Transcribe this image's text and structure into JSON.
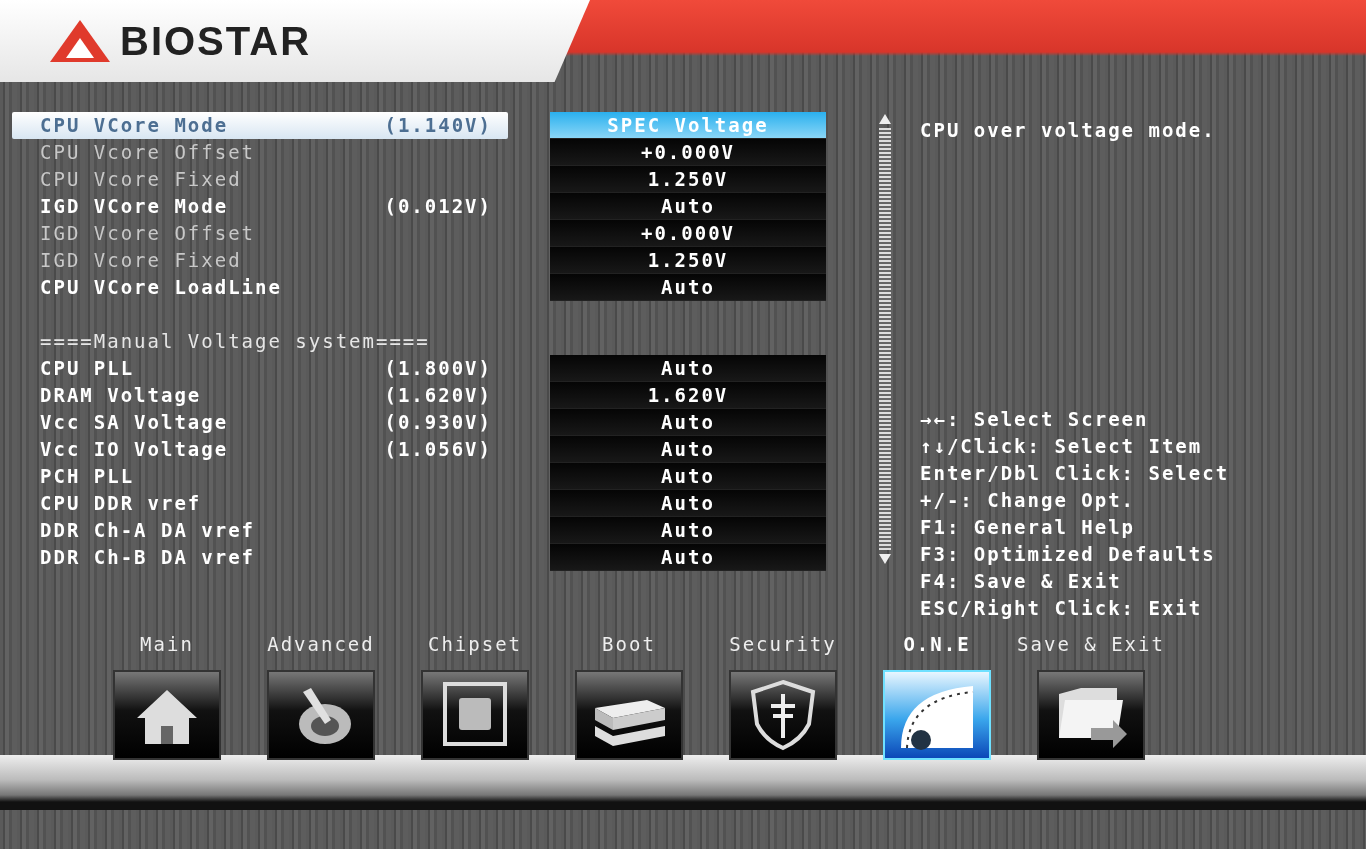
{
  "brand": {
    "name": "BIOSTAR"
  },
  "settings": [
    {
      "kind": "setting",
      "label": "CPU VCore Mode",
      "reading": "(1.140V)",
      "value": "SPEC Voltage",
      "disabled": false,
      "selected": true
    },
    {
      "kind": "setting",
      "label": "CPU Vcore Offset",
      "value": "+0.000V",
      "disabled": true,
      "selected": false
    },
    {
      "kind": "setting",
      "label": "CPU Vcore Fixed",
      "value": "1.250V",
      "disabled": true,
      "selected": false
    },
    {
      "kind": "setting",
      "label": "IGD VCore Mode",
      "reading": "(0.012V)",
      "value": "Auto",
      "disabled": false,
      "selected": false
    },
    {
      "kind": "setting",
      "label": "IGD Vcore Offset",
      "value": "+0.000V",
      "disabled": true,
      "selected": false
    },
    {
      "kind": "setting",
      "label": "IGD Vcore Fixed",
      "value": "1.250V",
      "disabled": true,
      "selected": false
    },
    {
      "kind": "setting",
      "label": "CPU VCore LoadLine",
      "value": "Auto",
      "disabled": false,
      "selected": false
    },
    {
      "kind": "heading",
      "label": "====Manual Voltage system===="
    },
    {
      "kind": "setting",
      "label": "CPU PLL",
      "reading": "(1.800V)",
      "value": "Auto",
      "disabled": false,
      "selected": false
    },
    {
      "kind": "setting",
      "label": "DRAM Voltage",
      "reading": "(1.620V)",
      "value": "1.620V",
      "disabled": false,
      "selected": false
    },
    {
      "kind": "setting",
      "label": "Vcc SA Voltage",
      "reading": "(0.930V)",
      "value": "Auto",
      "disabled": false,
      "selected": false
    },
    {
      "kind": "setting",
      "label": "Vcc IO Voltage",
      "reading": "(1.056V)",
      "value": "Auto",
      "disabled": false,
      "selected": false
    },
    {
      "kind": "setting",
      "label": "PCH PLL",
      "value": "Auto",
      "disabled": false,
      "selected": false
    },
    {
      "kind": "setting",
      "label": "CPU DDR vref",
      "value": "Auto",
      "disabled": false,
      "selected": false
    },
    {
      "kind": "setting",
      "label": "DDR Ch-A DA vref",
      "value": "Auto",
      "disabled": false,
      "selected": false
    },
    {
      "kind": "setting",
      "label": "DDR Ch-B DA vref",
      "value": "Auto",
      "disabled": false,
      "selected": false
    }
  ],
  "help": {
    "description": "CPU over voltage mode.",
    "keys": [
      "→←: Select Screen",
      "↑↓/Click: Select Item",
      "Enter/Dbl Click: Select",
      "+/-: Change Opt.",
      "F1: General Help",
      "F3: Optimized Defaults",
      "F4: Save & Exit",
      "ESC/Right Click: Exit"
    ]
  },
  "tabs": [
    {
      "label": "Main",
      "selected": false
    },
    {
      "label": "Advanced",
      "selected": false
    },
    {
      "label": "Chipset",
      "selected": false
    },
    {
      "label": "Boot",
      "selected": false
    },
    {
      "label": "Security",
      "selected": false
    },
    {
      "label": "O.N.E",
      "selected": true
    },
    {
      "label": "Save & Exit",
      "selected": false
    }
  ]
}
